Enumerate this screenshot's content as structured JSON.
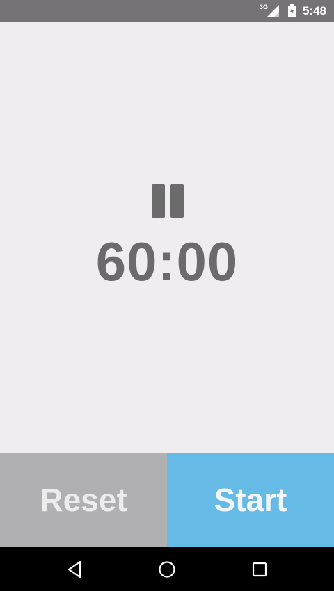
{
  "status_bar": {
    "network": "3G",
    "time": "5:48",
    "icons": [
      "signal-icon",
      "battery-icon"
    ]
  },
  "timer": {
    "display": "60:00",
    "state_icon": "pause-icon"
  },
  "actions": {
    "reset_label": "Reset",
    "start_label": "Start"
  },
  "nav_bar": {
    "icons": [
      "back-icon",
      "home-icon",
      "recents-icon"
    ]
  },
  "colors": {
    "status_bar": "#757375",
    "background": "#efedef",
    "timer_text": "#6c6b6c",
    "reset_button": "#b0afb1",
    "start_button": "#66bae6",
    "nav_bar": "#000000"
  }
}
